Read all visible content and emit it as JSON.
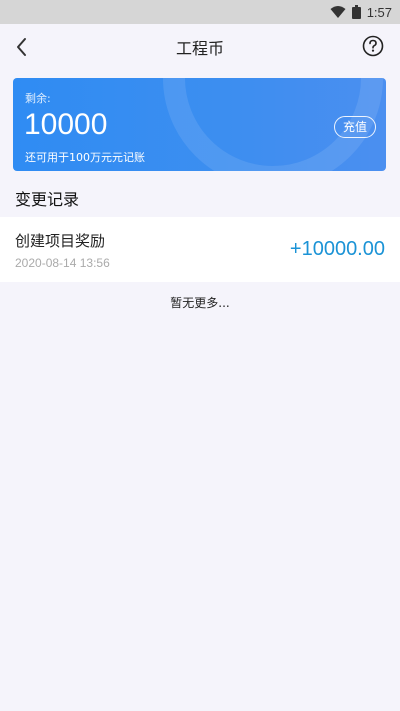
{
  "status_bar": {
    "time": "1:57",
    "icons": [
      "wifi-icon",
      "battery-icon"
    ]
  },
  "nav": {
    "title": "工程币",
    "back_icon": "chevron-left-icon",
    "help_icon": "question-circle-icon"
  },
  "balance_card": {
    "label": "剩余:",
    "amount": "10000",
    "note": "还可用于100万元元记账",
    "recharge_label": "充值",
    "gradient_colors": [
      "#2f8cf3",
      "#4b8ff0"
    ]
  },
  "records": {
    "title": "变更记录",
    "items": [
      {
        "name": "创建项目奖励",
        "time": "2020-08-14 13:56",
        "amount": "+10000.00"
      }
    ],
    "amount_color": "#1b93d6",
    "end_text": "暂无更多..."
  }
}
